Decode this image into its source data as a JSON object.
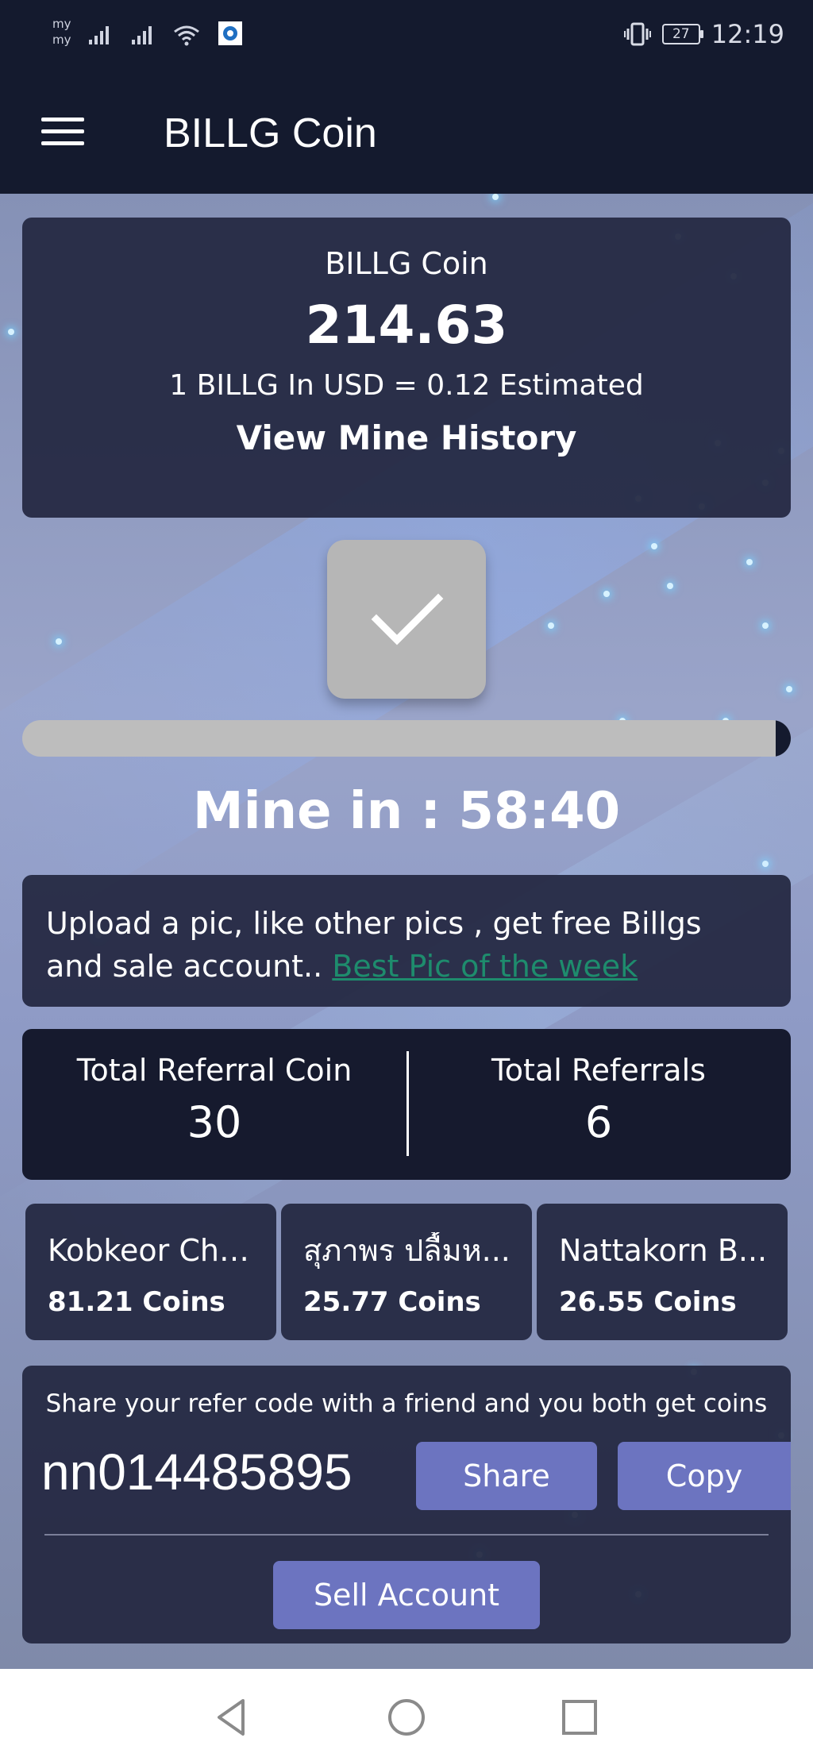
{
  "status_bar": {
    "carrier_1": "my",
    "carrier_2": "my",
    "battery_level": "27",
    "time": "12:19"
  },
  "app_bar": {
    "title": "BILLG Coin"
  },
  "balance_card": {
    "label": "BILLG Coin",
    "amount": "214.63",
    "rate": "1 BILLG In USD = 0.12 Estimated",
    "history_link": "View Mine History"
  },
  "mining": {
    "progress_remaining_fraction": 0.02,
    "timer_text": "Mine in : 58:40"
  },
  "promo": {
    "text": "Upload a pic, like other pics , get free Billgs and sale account.. ",
    "link": "Best Pic of the week "
  },
  "referrals": {
    "coin_label": "Total Referral Coin",
    "coin_value": "30",
    "count_label": "Total Referrals",
    "count_value": "6"
  },
  "members": [
    {
      "name": "Kobkeor Cha...",
      "coins": "81.21 Coins"
    },
    {
      "name": "สุภาพร ปลื้มห...",
      "coins": "25.77 Coins"
    },
    {
      "name": "Nattakorn B...",
      "coins": "26.55 Coins"
    }
  ],
  "share": {
    "text": "Share your refer code with a friend and you both get coins",
    "code": "nn014485895",
    "share_label": "Share",
    "copy_label": "Copy",
    "sell_label": "Sell Account"
  },
  "colors": {
    "app_bar": "#141a2e",
    "card": "#242842",
    "button": "#6c74c0",
    "link": "#1e8c6d"
  }
}
